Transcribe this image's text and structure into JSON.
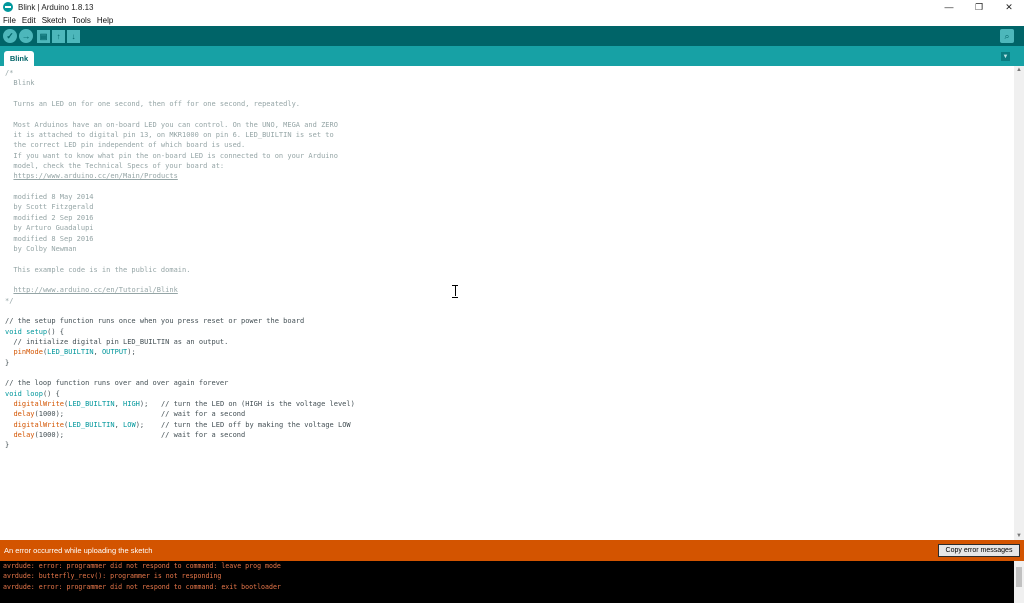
{
  "window": {
    "title": "Blink | Arduino 1.8.13",
    "minimize": "—",
    "restore": "❐",
    "close": "✕"
  },
  "menu": [
    "File",
    "Edit",
    "Sketch",
    "Tools",
    "Help"
  ],
  "toolbar": {
    "verify_icon": "✓",
    "upload_icon": "→",
    "new_icon": "▤",
    "open_icon": "↑",
    "save_icon": "↓",
    "serial_icon": "⌕"
  },
  "tabs": [
    {
      "label": "Blink"
    }
  ],
  "tab_menu_icon": "▼",
  "code_lines": [
    [
      {
        "t": "/*",
        "c": "comment"
      }
    ],
    [
      {
        "t": "  Blink",
        "c": "comment"
      }
    ],
    [
      {
        "t": "",
        "c": "comment"
      }
    ],
    [
      {
        "t": "  Turns an LED on for one second, then off for one second, repeatedly.",
        "c": "comment"
      }
    ],
    [
      {
        "t": "",
        "c": "comment"
      }
    ],
    [
      {
        "t": "  Most Arduinos have an on-board LED you can control. On the UNO, MEGA and ZERO",
        "c": "comment"
      }
    ],
    [
      {
        "t": "  it is attached to digital pin 13, on MKR1000 on pin 6. LED_BUILTIN is set to",
        "c": "comment"
      }
    ],
    [
      {
        "t": "  the correct LED pin independent of which board is used.",
        "c": "comment"
      }
    ],
    [
      {
        "t": "  If you want to know what pin the on-board LED is connected to on your Arduino",
        "c": "comment"
      }
    ],
    [
      {
        "t": "  model, check the Technical Specs of your board at:",
        "c": "comment"
      }
    ],
    [
      {
        "t": "  ",
        "c": "comment"
      },
      {
        "t": "https://www.arduino.cc/en/Main/Products",
        "c": "url"
      }
    ],
    [
      {
        "t": "",
        "c": "comment"
      }
    ],
    [
      {
        "t": "  modified 8 May 2014",
        "c": "comment"
      }
    ],
    [
      {
        "t": "  by Scott Fitzgerald",
        "c": "comment"
      }
    ],
    [
      {
        "t": "  modified 2 Sep 2016",
        "c": "comment"
      }
    ],
    [
      {
        "t": "  by Arturo Guadalupi",
        "c": "comment"
      }
    ],
    [
      {
        "t": "  modified 8 Sep 2016",
        "c": "comment"
      }
    ],
    [
      {
        "t": "  by Colby Newman",
        "c": "comment"
      }
    ],
    [
      {
        "t": "",
        "c": "comment"
      }
    ],
    [
      {
        "t": "  This example code is in the public domain.",
        "c": "comment"
      }
    ],
    [
      {
        "t": "",
        "c": "comment"
      }
    ],
    [
      {
        "t": "  ",
        "c": "comment"
      },
      {
        "t": "http://www.arduino.cc/en/Tutorial/Blink",
        "c": "url"
      }
    ],
    [
      {
        "t": "*/",
        "c": "comment"
      }
    ],
    [
      {
        "t": "",
        "c": "text"
      }
    ],
    [
      {
        "t": "// the setup function runs once when you press reset or power the board",
        "c": "text"
      }
    ],
    [
      {
        "t": "void",
        "c": "type"
      },
      {
        "t": " ",
        "c": "text"
      },
      {
        "t": "setup",
        "c": "type"
      },
      {
        "t": "() {",
        "c": "text"
      }
    ],
    [
      {
        "t": "  // initialize digital pin LED_BUILTIN as an output.",
        "c": "text"
      }
    ],
    [
      {
        "t": "  ",
        "c": "text"
      },
      {
        "t": "pinMode",
        "c": "fn"
      },
      {
        "t": "(",
        "c": "text"
      },
      {
        "t": "LED_BUILTIN",
        "c": "const"
      },
      {
        "t": ", ",
        "c": "text"
      },
      {
        "t": "OUTPUT",
        "c": "const"
      },
      {
        "t": ");",
        "c": "text"
      }
    ],
    [
      {
        "t": "}",
        "c": "text"
      }
    ],
    [
      {
        "t": "",
        "c": "text"
      }
    ],
    [
      {
        "t": "// the loop function runs over and over again forever",
        "c": "text"
      }
    ],
    [
      {
        "t": "void",
        "c": "type"
      },
      {
        "t": " ",
        "c": "text"
      },
      {
        "t": "loop",
        "c": "type"
      },
      {
        "t": "() {",
        "c": "text"
      }
    ],
    [
      {
        "t": "  ",
        "c": "text"
      },
      {
        "t": "digitalWrite",
        "c": "fn"
      },
      {
        "t": "(",
        "c": "text"
      },
      {
        "t": "LED_BUILTIN",
        "c": "const"
      },
      {
        "t": ", ",
        "c": "text"
      },
      {
        "t": "HIGH",
        "c": "const"
      },
      {
        "t": ");   // turn the LED on (HIGH is the voltage level)",
        "c": "text"
      }
    ],
    [
      {
        "t": "  ",
        "c": "text"
      },
      {
        "t": "delay",
        "c": "fn"
      },
      {
        "t": "(1000);                       // wait for a second",
        "c": "text"
      }
    ],
    [
      {
        "t": "  ",
        "c": "text"
      },
      {
        "t": "digitalWrite",
        "c": "fn"
      },
      {
        "t": "(",
        "c": "text"
      },
      {
        "t": "LED_BUILTIN",
        "c": "const"
      },
      {
        "t": ", ",
        "c": "text"
      },
      {
        "t": "LOW",
        "c": "const"
      },
      {
        "t": ");    // turn the LED off by making the voltage LOW",
        "c": "text"
      }
    ],
    [
      {
        "t": "  ",
        "c": "text"
      },
      {
        "t": "delay",
        "c": "fn"
      },
      {
        "t": "(1000);                       // wait for a second",
        "c": "text"
      }
    ],
    [
      {
        "t": "}",
        "c": "text"
      }
    ]
  ],
  "status": {
    "message": "An error occurred while uploading the sketch",
    "copy_button": "Copy error messages"
  },
  "console_lines": [
    "avrdude: error: programmer did not respond to command: leave prog mode",
    "avrdude: butterfly_recv(): programmer is not responding",
    "avrdude: error: programmer did not respond to command: exit bootloader"
  ],
  "colors": {
    "toolbar": "#006468",
    "tabbar": "#17a1a5",
    "error_bar": "#d35400",
    "console_text": "#e8774a"
  }
}
